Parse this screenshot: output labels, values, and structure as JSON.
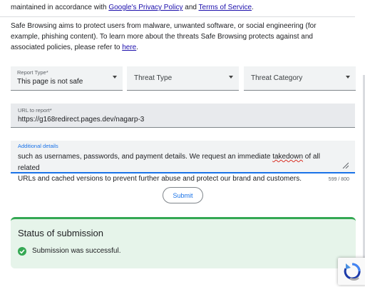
{
  "intro": {
    "line_prefix": "maintained in accordance with ",
    "privacy_link": "Google's Privacy Policy",
    "and": " and ",
    "terms_link": "Terms of Service",
    "period": "."
  },
  "paragraph": {
    "text": "Safe Browsing aims to protect users from malware, unwanted software, or social engineering (for example, phishing content). To learn more about the threats Safe Browsing protects against and associated policies, please refer to ",
    "link": "here",
    "end": "."
  },
  "report_type": {
    "label": "Report Type*",
    "value": "This page is not safe"
  },
  "threat_type": {
    "placeholder": "Threat Type"
  },
  "threat_category": {
    "placeholder": "Threat Category"
  },
  "url_field": {
    "label": "URL to report*",
    "value": "https://g168redirect.pages.dev/nagarp-3"
  },
  "details_field": {
    "label": "Additional details",
    "line1_before": "such as usernames, passwords, and payment details. We request an immediate ",
    "line1_misspelled": "takedown",
    "line1_after": " of all related",
    "line2": "URLs and cached versions to prevent further abuse and protect our brand and customers."
  },
  "counter": "599 / 800",
  "submit": {
    "label": "Submit"
  },
  "status": {
    "title": "Status of submission",
    "message": "Submission was successful."
  },
  "colors": {
    "accent": "#1a73e8",
    "success": "#34a853",
    "success_bg": "#e6f4ea",
    "link": "#1a0dab"
  },
  "icons": [
    "caret-down-icon",
    "check-circle-icon",
    "resize-handle-icon",
    "recaptcha-icon"
  ]
}
